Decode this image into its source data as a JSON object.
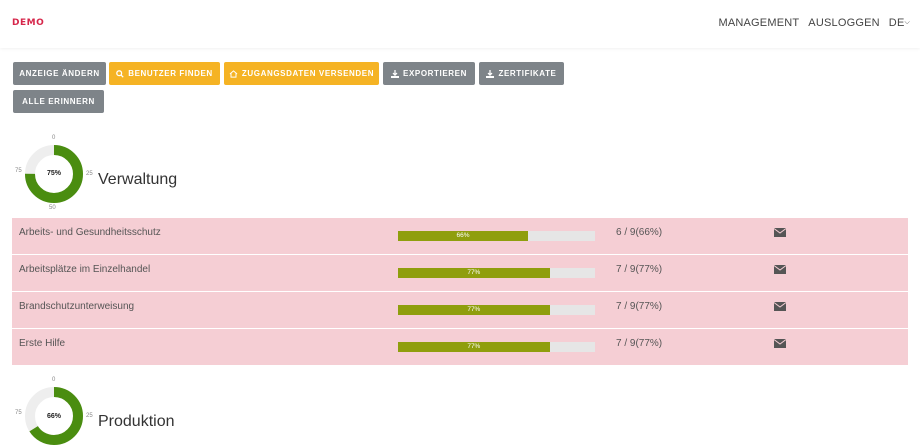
{
  "header": {
    "logo": "DEMO",
    "nav": [
      "MANAGEMENT",
      "AUSLOGGEN",
      "DE"
    ]
  },
  "toolbar": {
    "change_view": "ANZEIGE ÄNDERN",
    "find_users": "BENUTZER FINDEN",
    "send_credentials": "ZUGANGSDATEN VERSENDEN",
    "export": "EXPORTIEREN",
    "certificates": "ZERTIFIKATE",
    "remind_all": "ALLE ERINNERN"
  },
  "sections": [
    {
      "title": "Verwaltung",
      "percent": 75,
      "percent_label": "75%",
      "ticks": [
        "0",
        "25",
        "50",
        "75"
      ],
      "rows": [
        {
          "name": "Arbeits- und Gesundheitsschutz",
          "progress": 66,
          "progress_label": "66%",
          "count": "6 / 9(66%)"
        },
        {
          "name": "Arbeitsplätze im Einzelhandel",
          "progress": 77,
          "progress_label": "77%",
          "count": "7 / 9(77%)"
        },
        {
          "name": "Brandschutzunterweisung",
          "progress": 77,
          "progress_label": "77%",
          "count": "7 / 9(77%)"
        },
        {
          "name": "Erste Hilfe",
          "progress": 77,
          "progress_label": "77%",
          "count": "7 / 9(77%)"
        }
      ]
    },
    {
      "title": "Produktion",
      "percent": 66,
      "percent_label": "66%",
      "ticks": [
        "0",
        "25",
        "75"
      ]
    }
  ],
  "colors": {
    "brand": "#d6264a",
    "donut_fill": "#4a8d10",
    "donut_track": "#eeeeee",
    "bar_fill": "#8f9e0d",
    "row_bg": "#f5ced4",
    "button_grey": "#7e8489",
    "button_yellow": "#f5b324"
  },
  "icons": {
    "search": "search-icon",
    "home": "home-icon",
    "download": "download-icon",
    "mail": "envelope-icon"
  }
}
